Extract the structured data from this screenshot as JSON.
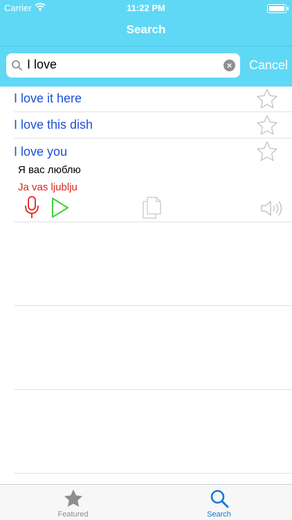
{
  "status_bar": {
    "carrier": "Carrier",
    "time": "11:22 PM"
  },
  "nav": {
    "title": "Search"
  },
  "search": {
    "value": "I love",
    "cancel_label": "Cancel"
  },
  "results": [
    {
      "phrase": "I love it here"
    },
    {
      "phrase": "I love this dish"
    },
    {
      "phrase": "I love you",
      "translation": "Я вас люблю",
      "transliteration": "Ja vas ljublju"
    }
  ],
  "tabs": [
    {
      "label": "Featured",
      "icon": "star-icon",
      "selected": false
    },
    {
      "label": "Search",
      "icon": "search-icon",
      "selected": true
    }
  ],
  "colors": {
    "accent": "#5fd8f5",
    "phrase_text": "#1f4fd6",
    "transliteration_text": "#e0251b",
    "mic": "#e0251b",
    "play": "#3ccf3c",
    "tab_selected": "#1478d6",
    "tab_unselected": "#8e8e8e"
  }
}
